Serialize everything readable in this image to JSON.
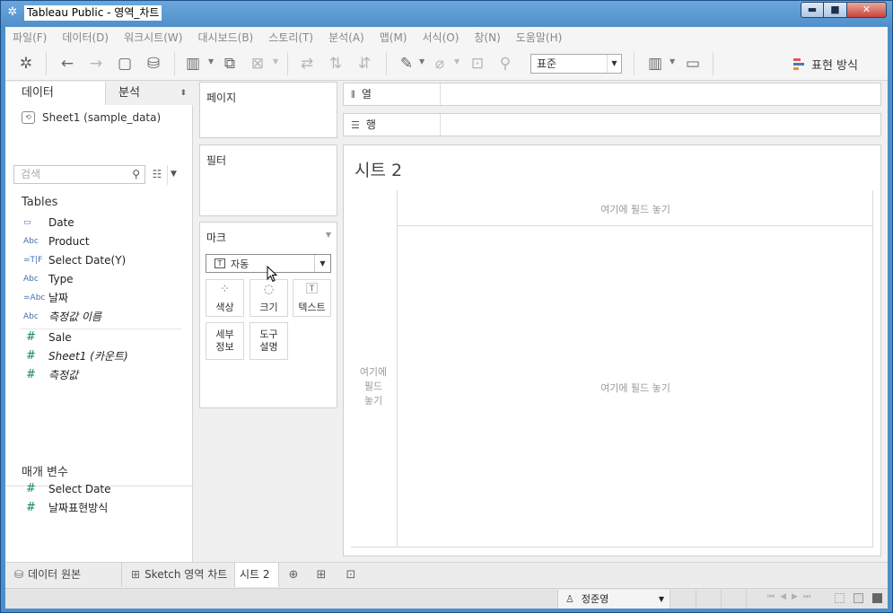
{
  "window": {
    "title": "Tableau Public - 영역_차트",
    "controls": {
      "minimize": "▬",
      "maximize": "■",
      "close": "✕"
    }
  },
  "menu": [
    "파일(F)",
    "데이터(D)",
    "워크시트(W)",
    "대시보드(B)",
    "스토리(T)",
    "분석(A)",
    "맵(M)",
    "서식(O)",
    "창(N)",
    "도움말(H)"
  ],
  "toolbar": {
    "icons": [
      "tableau-logo-icon",
      "undo-icon",
      "redo-icon",
      "save-icon",
      "new-datasource-icon",
      "new-worksheet-icon",
      "duplicate-icon",
      "clear-icon",
      "swap-icon",
      "sort-asc-icon",
      "sort-desc-icon",
      "highlight-icon",
      "group-icon",
      "label-icon",
      "pin-icon",
      "show-cards-icon",
      "presentation-icon"
    ],
    "fit_select": "표준",
    "show_me": "표현 방식",
    "show_me_colors": [
      "#e15759",
      "#4e79a7",
      "#f28e2b"
    ]
  },
  "data_pane": {
    "tabs": {
      "data": "데이터",
      "analytics": "분석"
    },
    "datasource": "Sheet1 (sample_data)",
    "search_placeholder": "검색",
    "tables_header": "Tables",
    "dimensions": [
      {
        "icon": "date",
        "icon_text": "▭",
        "label": "Date",
        "italic": false
      },
      {
        "icon": "string",
        "icon_text": "Abc",
        "label": "Product",
        "italic": false
      },
      {
        "icon": "calc-tf",
        "icon_text": "=T|F",
        "label": "Select Date(Y)",
        "italic": false
      },
      {
        "icon": "string",
        "icon_text": "Abc",
        "label": "Type",
        "italic": false
      },
      {
        "icon": "calc-string",
        "icon_text": "=Abc",
        "label": "날짜",
        "italic": false
      },
      {
        "icon": "string",
        "icon_text": "Abc",
        "label": "측정값 이름",
        "italic": true
      }
    ],
    "measures": [
      {
        "label": "Sale",
        "italic": false
      },
      {
        "label": "Sheet1 (카운트)",
        "italic": true
      },
      {
        "label": "측정값",
        "italic": true
      }
    ],
    "parameters_header": "매개 변수",
    "parameters": [
      "Select Date",
      "날짜표현방식"
    ]
  },
  "cards": {
    "pages": "페이지",
    "filters": "필터",
    "marks": "마크",
    "mark_type": "자동",
    "mark_buttons": {
      "color": "색상",
      "size": "크기",
      "text": "텍스트",
      "detail_line1": "세부",
      "detail_line2": "정보",
      "tooltip_line1": "도구",
      "tooltip_line2": "설명"
    }
  },
  "shelves": {
    "columns": "열",
    "rows": "행"
  },
  "view": {
    "title": "시트 2",
    "drop_top": "여기에 필드 놓기",
    "drop_center": "여기에 필드 놓기",
    "drop_left_1": "여기에",
    "drop_left_2": "필드",
    "drop_left_3": "놓기"
  },
  "sheet_tabs": {
    "datasource": "데이터 원본",
    "sheets": [
      "Sketch 영역 차트",
      "시트 2"
    ],
    "active": "시트 2"
  },
  "status": {
    "user": "정준영"
  }
}
